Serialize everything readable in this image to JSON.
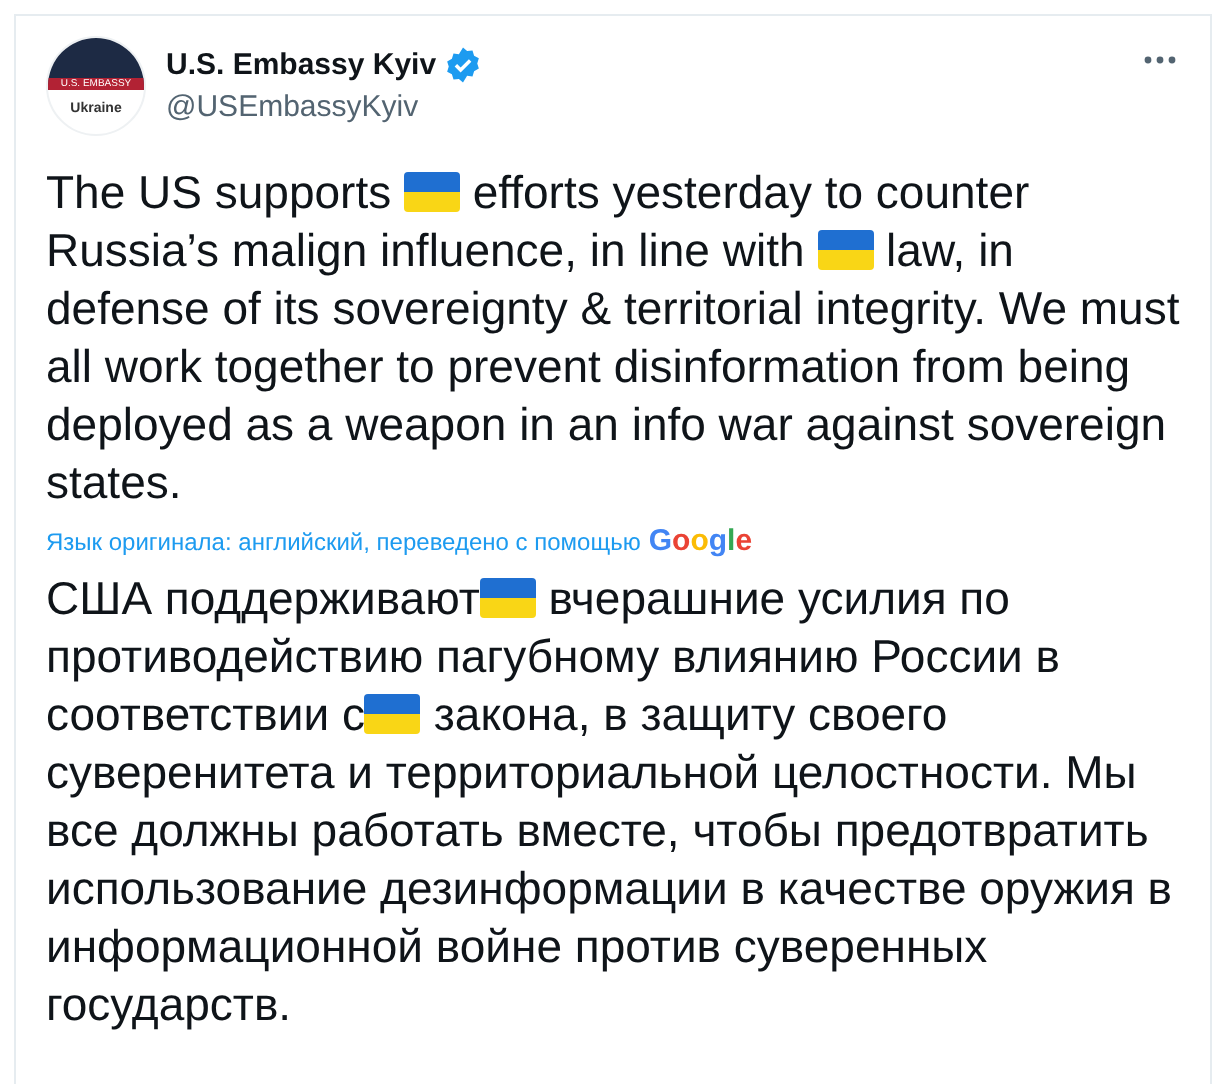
{
  "author": {
    "avatar": {
      "banner": "U.S. EMBASSY",
      "caption": "Ukraine"
    },
    "name": "U.S. Embassy Kyiv",
    "verified": true,
    "handle": "@USEmbassyKyiv"
  },
  "original": [
    {
      "kind": "text",
      "text": "The US supports "
    },
    {
      "kind": "flag"
    },
    {
      "kind": "text",
      "text": " efforts yesterday to counter Russia’s malign influence, in line with "
    },
    {
      "kind": "flag"
    },
    {
      "kind": "text",
      "text": " law, in defense of its sovereignty & territorial integrity. We must all work together to prevent disinformation from being deployed as a weapon in an info war against sovereign states."
    }
  ],
  "translation_note": {
    "text": "Язык оригинала: английский, переведено с помощью",
    "logo": "Google"
  },
  "translated": [
    {
      "kind": "text",
      "text": "США поддерживают"
    },
    {
      "kind": "flag"
    },
    {
      "kind": "text",
      "text": " вчерашние усилия по противодействию пагубному влиянию России в соответствии с"
    },
    {
      "kind": "flag"
    },
    {
      "kind": "text",
      "text": " закона, в защиту своего суверенитета и территориальной целостности. Мы все должны работать вместе, чтобы предотвратить использование дезинформации в качестве оружия в информационной войне против суверенных государств."
    }
  ]
}
